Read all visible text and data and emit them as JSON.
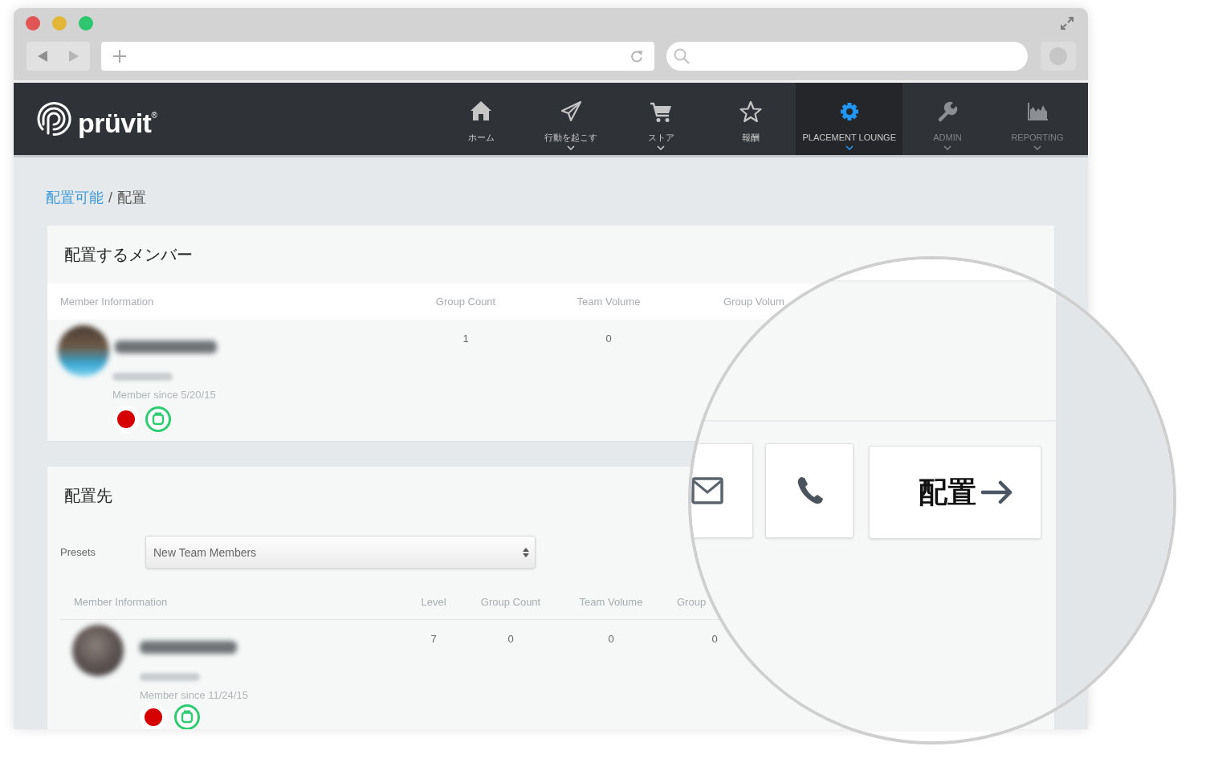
{
  "navbar": {
    "logo": "prüvit$^{®}$",
    "items": [
      {
        "label": "ホーム",
        "selected": false,
        "has_menu": false,
        "disabled": false
      },
      {
        "label": "行動を起こす",
        "selected": false,
        "has_menu": true,
        "disabled": false
      },
      {
        "label": "ストア",
        "selected": false,
        "has_menu": true,
        "disabled": false
      },
      {
        "label": "報酬",
        "selected": false,
        "has_menu": false,
        "disabled": false
      },
      {
        "label": "PLACEMENT LOUNGE",
        "selected": true,
        "has_menu": true,
        "disabled": false
      },
      {
        "label": "ADMIN",
        "selected": false,
        "has_menu": true,
        "disabled": true
      },
      {
        "label": "REPORTING",
        "selected": false,
        "has_menu": true,
        "disabled": true
      }
    ]
  },
  "breadcrumb": {
    "items": [
      {
        "label": "配置可能",
        "link": true
      },
      {
        "label": "配置",
        "link": false
      }
    ],
    "separator": "/"
  },
  "member_card": {
    "title": "配置するメンバー",
    "columns": [
      "Member Information",
      "Group Count",
      "Team Volume",
      "Group Volum"
    ],
    "rows": [
      {
        "cells": [
          "Member since 5/20/15",
          "1",
          "0"
        ]
      }
    ]
  },
  "placement_card": {
    "title": "配置先",
    "presets": {
      "label": "Presets",
      "value": "New Team Members"
    },
    "columns": [
      "Member Information",
      "Level",
      "Group Count",
      "Team Volume",
      "Group"
    ],
    "rows": [
      {
        "cells": [
          "Member since 11/24/15",
          "7",
          "0",
          "0",
          "0"
        ]
      }
    ]
  },
  "magnifier": {
    "action_button": {
      "label": "配置"
    }
  }
}
